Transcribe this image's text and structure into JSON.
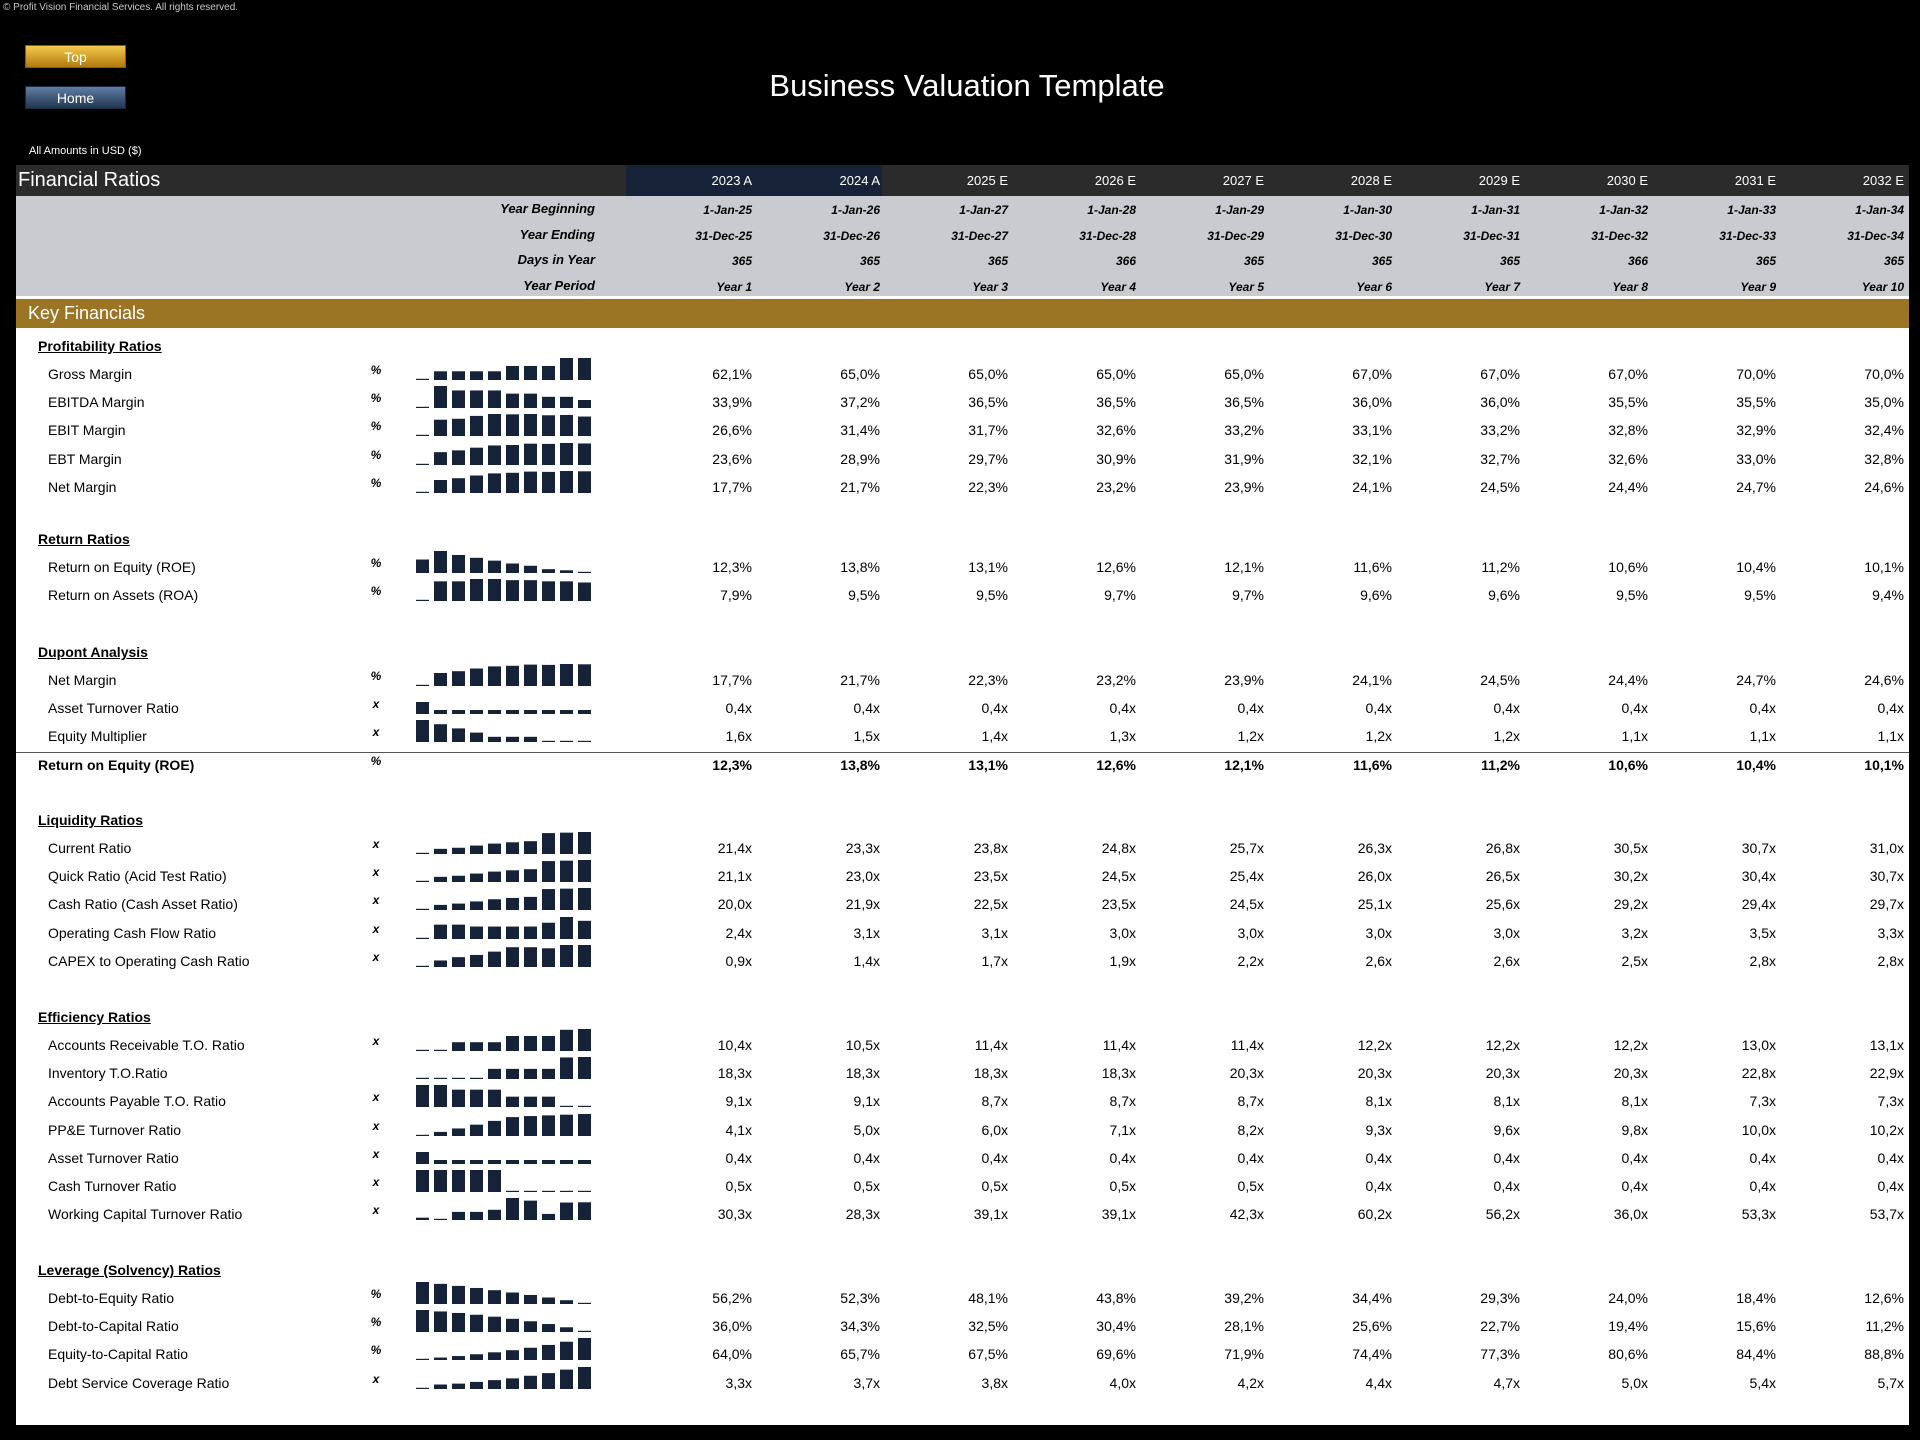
{
  "copyright": "© Profit Vision Financial Services. All rights reserved.",
  "nav": {
    "top_label": "Top",
    "home_label": "Home"
  },
  "page_title": "Business Valuation Template",
  "amounts_note": "All Amounts in  USD ($)",
  "sheet_title": "Financial Ratios",
  "key_financials": "Key Financials",
  "years": [
    "2023 A",
    "2024 A",
    "2025 E",
    "2026 E",
    "2027 E",
    "2028 E",
    "2029 E",
    "2030 E",
    "2031 E",
    "2032 E"
  ],
  "date_rows": [
    {
      "label": "Year Beginning",
      "values": [
        "1-Jan-25",
        "1-Jan-26",
        "1-Jan-27",
        "1-Jan-28",
        "1-Jan-29",
        "1-Jan-30",
        "1-Jan-31",
        "1-Jan-32",
        "1-Jan-33",
        "1-Jan-34"
      ]
    },
    {
      "label": "Year Ending",
      "values": [
        "31-Dec-25",
        "31-Dec-26",
        "31-Dec-27",
        "31-Dec-28",
        "31-Dec-29",
        "31-Dec-30",
        "31-Dec-31",
        "31-Dec-32",
        "31-Dec-33",
        "31-Dec-34"
      ]
    },
    {
      "label": "Days in Year",
      "values": [
        "365",
        "365",
        "365",
        "366",
        "365",
        "365",
        "365",
        "366",
        "365",
        "365"
      ]
    },
    {
      "label": "Year Period",
      "values": [
        "Year 1",
        "Year 2",
        "Year 3",
        "Year 4",
        "Year 5",
        "Year 6",
        "Year 7",
        "Year 8",
        "Year 9",
        "Year 10"
      ]
    }
  ],
  "sections": [
    {
      "title": "Profitability Ratios",
      "rows": [
        {
          "label": "Gross Margin",
          "unit": "%",
          "spark": true,
          "values": [
            "62,1%",
            "65,0%",
            "65,0%",
            "65,0%",
            "65,0%",
            "67,0%",
            "67,0%",
            "67,0%",
            "70,0%",
            "70,0%"
          ]
        },
        {
          "label": "EBITDA Margin",
          "unit": "%",
          "spark": true,
          "values": [
            "33,9%",
            "37,2%",
            "36,5%",
            "36,5%",
            "36,5%",
            "36,0%",
            "36,0%",
            "35,5%",
            "35,5%",
            "35,0%"
          ]
        },
        {
          "label": "EBIT Margin",
          "unit": "%",
          "spark": true,
          "values": [
            "26,6%",
            "31,4%",
            "31,7%",
            "32,6%",
            "33,2%",
            "33,1%",
            "33,2%",
            "32,8%",
            "32,9%",
            "32,4%"
          ]
        },
        {
          "label": "EBT Margin",
          "unit": "%",
          "spark": true,
          "values": [
            "23,6%",
            "28,9%",
            "29,7%",
            "30,9%",
            "31,9%",
            "32,1%",
            "32,7%",
            "32,6%",
            "33,0%",
            "32,8%"
          ]
        },
        {
          "label": "Net Margin",
          "unit": "%",
          "spark": true,
          "values": [
            "17,7%",
            "21,7%",
            "22,3%",
            "23,2%",
            "23,9%",
            "24,1%",
            "24,5%",
            "24,4%",
            "24,7%",
            "24,6%"
          ]
        }
      ]
    },
    {
      "title": "Return Ratios",
      "rows": [
        {
          "label": "Return on Equity (ROE)",
          "unit": "%",
          "spark": true,
          "values": [
            "12,3%",
            "13,8%",
            "13,1%",
            "12,6%",
            "12,1%",
            "11,6%",
            "11,2%",
            "10,6%",
            "10,4%",
            "10,1%"
          ]
        },
        {
          "label": "Return on Assets (ROA)",
          "unit": "%",
          "spark": true,
          "values": [
            "7,9%",
            "9,5%",
            "9,5%",
            "9,7%",
            "9,7%",
            "9,6%",
            "9,6%",
            "9,5%",
            "9,5%",
            "9,4%"
          ]
        }
      ]
    },
    {
      "title": "Dupont Analysis",
      "rows": [
        {
          "label": "Net Margin",
          "unit": "%",
          "spark": true,
          "values": [
            "17,7%",
            "21,7%",
            "22,3%",
            "23,2%",
            "23,9%",
            "24,1%",
            "24,5%",
            "24,4%",
            "24,7%",
            "24,6%"
          ]
        },
        {
          "label": "Asset Turnover Ratio",
          "unit": "x",
          "spark": true,
          "values": [
            "0,4x",
            "0,4x",
            "0,4x",
            "0,4x",
            "0,4x",
            "0,4x",
            "0,4x",
            "0,4x",
            "0,4x",
            "0,4x"
          ]
        },
        {
          "label": "Equity Multiplier",
          "unit": "x",
          "spark": true,
          "values": [
            "1,6x",
            "1,5x",
            "1,4x",
            "1,3x",
            "1,2x",
            "1,2x",
            "1,2x",
            "1,1x",
            "1,1x",
            "1,1x"
          ]
        },
        {
          "label": "Return on Equity (ROE)",
          "unit": "%",
          "spark": false,
          "bold": true,
          "values": [
            "12,3%",
            "13,8%",
            "13,1%",
            "12,6%",
            "12,1%",
            "11,6%",
            "11,2%",
            "10,6%",
            "10,4%",
            "10,1%"
          ]
        }
      ]
    },
    {
      "title": "Liquidity Ratios",
      "rows": [
        {
          "label": "Current Ratio",
          "unit": "x",
          "spark": true,
          "values": [
            "21,4x",
            "23,3x",
            "23,8x",
            "24,8x",
            "25,7x",
            "26,3x",
            "26,8x",
            "30,5x",
            "30,7x",
            "31,0x"
          ]
        },
        {
          "label": "Quick Ratio (Acid Test Ratio)",
          "unit": "x",
          "spark": true,
          "values": [
            "21,1x",
            "23,0x",
            "23,5x",
            "24,5x",
            "25,4x",
            "26,0x",
            "26,5x",
            "30,2x",
            "30,4x",
            "30,7x"
          ]
        },
        {
          "label": "Cash Ratio (Cash Asset Ratio)",
          "unit": "x",
          "spark": true,
          "values": [
            "20,0x",
            "21,9x",
            "22,5x",
            "23,5x",
            "24,5x",
            "25,1x",
            "25,6x",
            "29,2x",
            "29,4x",
            "29,7x"
          ]
        },
        {
          "label": "Operating Cash Flow Ratio",
          "unit": "x",
          "spark": true,
          "values": [
            "2,4x",
            "3,1x",
            "3,1x",
            "3,0x",
            "3,0x",
            "3,0x",
            "3,0x",
            "3,2x",
            "3,5x",
            "3,3x"
          ]
        },
        {
          "label": "CAPEX to Operating Cash Ratio",
          "unit": "x",
          "spark": true,
          "values": [
            "0,9x",
            "1,4x",
            "1,7x",
            "1,9x",
            "2,2x",
            "2,6x",
            "2,6x",
            "2,5x",
            "2,8x",
            "2,8x"
          ]
        }
      ]
    },
    {
      "title": "Efficiency Ratios",
      "rows": [
        {
          "label": "Accounts Receivable T.O. Ratio",
          "unit": "x",
          "spark": true,
          "values": [
            "10,4x",
            "10,5x",
            "11,4x",
            "11,4x",
            "11,4x",
            "12,2x",
            "12,2x",
            "12,2x",
            "13,0x",
            "13,1x"
          ]
        },
        {
          "label": "Inventory T.O.Ratio",
          "unit": "",
          "spark": true,
          "values": [
            "18,3x",
            "18,3x",
            "18,3x",
            "18,3x",
            "20,3x",
            "20,3x",
            "20,3x",
            "20,3x",
            "22,8x",
            "22,9x"
          ]
        },
        {
          "label": "Accounts Payable T.O. Ratio",
          "unit": "x",
          "spark": true,
          "values": [
            "9,1x",
            "9,1x",
            "8,7x",
            "8,7x",
            "8,7x",
            "8,1x",
            "8,1x",
            "8,1x",
            "7,3x",
            "7,3x"
          ]
        },
        {
          "label": "PP&E Turnover Ratio",
          "unit": "x",
          "spark": true,
          "values": [
            "4,1x",
            "5,0x",
            "6,0x",
            "7,1x",
            "8,2x",
            "9,3x",
            "9,6x",
            "9,8x",
            "10,0x",
            "10,2x"
          ]
        },
        {
          "label": "Asset Turnover Ratio",
          "unit": "x",
          "spark": true,
          "values": [
            "0,4x",
            "0,4x",
            "0,4x",
            "0,4x",
            "0,4x",
            "0,4x",
            "0,4x",
            "0,4x",
            "0,4x",
            "0,4x"
          ]
        },
        {
          "label": "Cash Turnover Ratio",
          "unit": "x",
          "spark": true,
          "values": [
            "0,5x",
            "0,5x",
            "0,5x",
            "0,5x",
            "0,5x",
            "0,4x",
            "0,4x",
            "0,4x",
            "0,4x",
            "0,4x"
          ]
        },
        {
          "label": "Working Capital Turnover Ratio",
          "unit": "x",
          "spark": true,
          "values": [
            "30,3x",
            "28,3x",
            "39,1x",
            "39,1x",
            "42,3x",
            "60,2x",
            "56,2x",
            "36,0x",
            "53,3x",
            "53,7x"
          ]
        }
      ]
    },
    {
      "title": "Leverage (Solvency) Ratios",
      "rows": [
        {
          "label": "Debt-to-Equity Ratio",
          "unit": "%",
          "spark": true,
          "values": [
            "56,2%",
            "52,3%",
            "48,1%",
            "43,8%",
            "39,2%",
            "34,4%",
            "29,3%",
            "24,0%",
            "18,4%",
            "12,6%"
          ]
        },
        {
          "label": "Debt-to-Capital Ratio",
          "unit": "%",
          "spark": true,
          "values": [
            "36,0%",
            "34,3%",
            "32,5%",
            "30,4%",
            "28,1%",
            "25,6%",
            "22,7%",
            "19,4%",
            "15,6%",
            "11,2%"
          ]
        },
        {
          "label": "Equity-to-Capital Ratio",
          "unit": "%",
          "spark": true,
          "values": [
            "64,0%",
            "65,7%",
            "67,5%",
            "69,6%",
            "71,9%",
            "74,4%",
            "77,3%",
            "80,6%",
            "84,4%",
            "88,8%"
          ]
        },
        {
          "label": "Debt Service Coverage Ratio",
          "unit": "x",
          "spark": true,
          "values": [
            "3,3x",
            "3,7x",
            "3,8x",
            "4,0x",
            "4,2x",
            "4,4x",
            "4,7x",
            "5,0x",
            "5,4x",
            "5,7x"
          ]
        }
      ]
    }
  ]
}
